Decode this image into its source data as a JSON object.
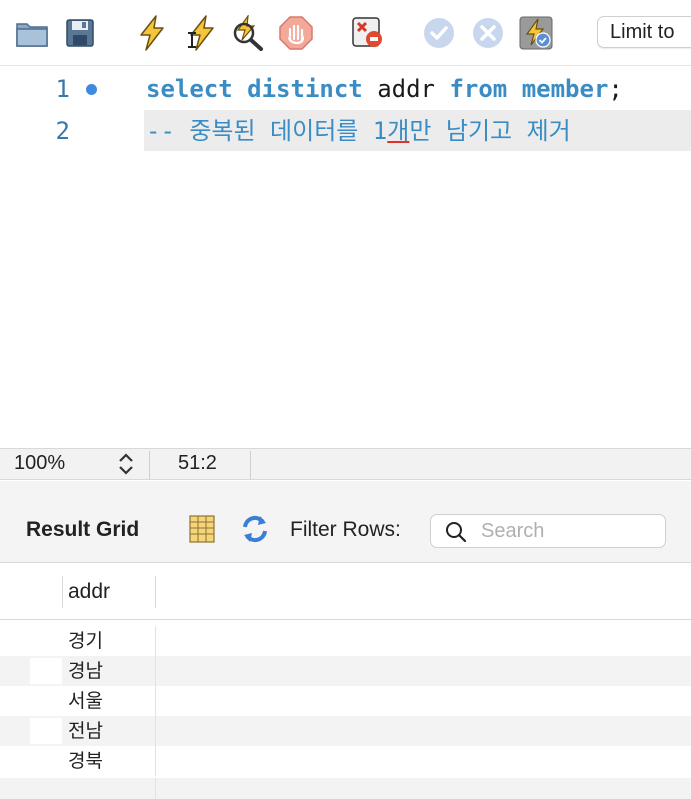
{
  "toolbar": {
    "icons": [
      "folder-icon",
      "save-icon",
      "execute-icon",
      "execute-current-icon",
      "explain-icon",
      "stop-icon",
      "toggle-error-icon",
      "commit-icon",
      "rollback-icon",
      "autocommit-icon"
    ],
    "limit_label": "Limit to"
  },
  "editor": {
    "lines": [
      {
        "number": "1",
        "tokens": [
          {
            "text": "select",
            "kind": "kw"
          },
          {
            "text": " ",
            "kind": "plain"
          },
          {
            "text": "distinct",
            "kind": "kw"
          },
          {
            "text": " addr ",
            "kind": "plain"
          },
          {
            "text": "from",
            "kind": "kw"
          },
          {
            "text": " ",
            "kind": "plain"
          },
          {
            "text": "member",
            "kind": "kw"
          },
          {
            "text": ";",
            "kind": "plain"
          }
        ]
      },
      {
        "number": "2",
        "comment_before": "-- 중복된 데이터를 1",
        "comment_underlined": "개",
        "comment_after": "만 남기고 제거"
      }
    ]
  },
  "status": {
    "zoom": "100%",
    "position": "51:2"
  },
  "result": {
    "title": "Result Grid",
    "filter_label": "Filter Rows:",
    "search_placeholder": "Search",
    "columns": [
      "addr"
    ],
    "rows": [
      "경기",
      "경남",
      "서울",
      "전남",
      "경북",
      ""
    ]
  },
  "colors": {
    "keyword": "#3a8cc4",
    "line_number": "#3a78a8",
    "breakpoint_dot": "#3d8be0",
    "current_line_bg": "#ececec"
  }
}
